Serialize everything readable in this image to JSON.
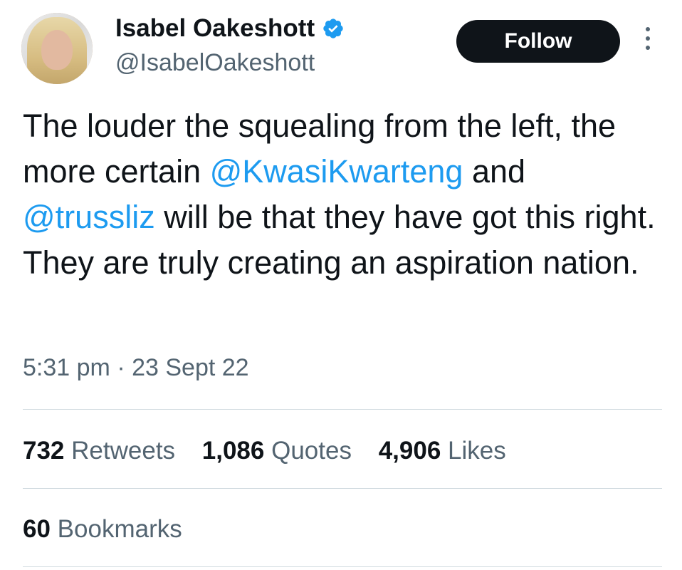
{
  "author": {
    "name": "Isabel Oakeshott",
    "handle": "@IsabelOakeshott",
    "verified": true
  },
  "follow_label": "Follow",
  "tweet": {
    "text_part1": "The louder the squealing from the left, the more certain ",
    "mention1": "@KwasiKwarteng",
    "text_part2": " and ",
    "mention2": "@trussliz",
    "text_part3": " will be that they have got this right. They are truly creating an aspiration nation."
  },
  "timestamp": {
    "time": "5:31 pm",
    "separator": "·",
    "date": "23 Sept 22"
  },
  "stats": {
    "retweets_count": "732",
    "retweets_label": "Retweets",
    "quotes_count": "1,086",
    "quotes_label": "Quotes",
    "likes_count": "4,906",
    "likes_label": "Likes",
    "bookmarks_count": "60",
    "bookmarks_label": "Bookmarks"
  },
  "colors": {
    "accent": "#1d9bf0",
    "text": "#0f1419",
    "secondary": "#536471",
    "divider": "#cfd9de"
  },
  "icons": {
    "verified": "verified-badge-icon",
    "more": "more-options-icon"
  }
}
